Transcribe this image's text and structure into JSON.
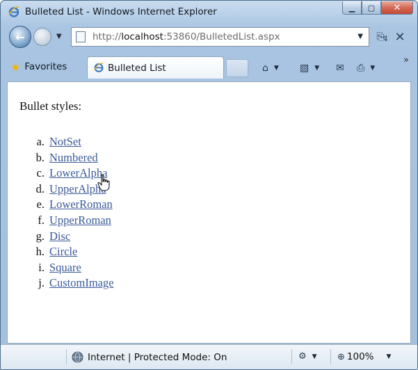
{
  "window": {
    "title": "Bulleted List - Windows Internet Explorer"
  },
  "address": {
    "url_prefix": "http://",
    "url_host": "localhost",
    "url_rest": ":53860/BulletedList.aspx"
  },
  "favorites": {
    "label": "Favorites"
  },
  "tab": {
    "label": "Bulleted List"
  },
  "content": {
    "heading": "Bullet styles:",
    "items": [
      {
        "marker": "a.",
        "label": "NotSet"
      },
      {
        "marker": "b.",
        "label": "Numbered"
      },
      {
        "marker": "c.",
        "label": "LowerAlpha"
      },
      {
        "marker": "d.",
        "label": "UpperAlpha"
      },
      {
        "marker": "e.",
        "label": "LowerRoman"
      },
      {
        "marker": "f.",
        "label": "UpperRoman"
      },
      {
        "marker": "g.",
        "label": "Disc"
      },
      {
        "marker": "h.",
        "label": "Circle"
      },
      {
        "marker": "i.",
        "label": "Square"
      },
      {
        "marker": "j.",
        "label": "CustomImage"
      }
    ]
  },
  "status": {
    "zone": "Internet | Protected Mode: On",
    "zoom": "100%"
  },
  "colors": {
    "link": "#3a5a9a",
    "chrome": "#a9c5e2"
  }
}
